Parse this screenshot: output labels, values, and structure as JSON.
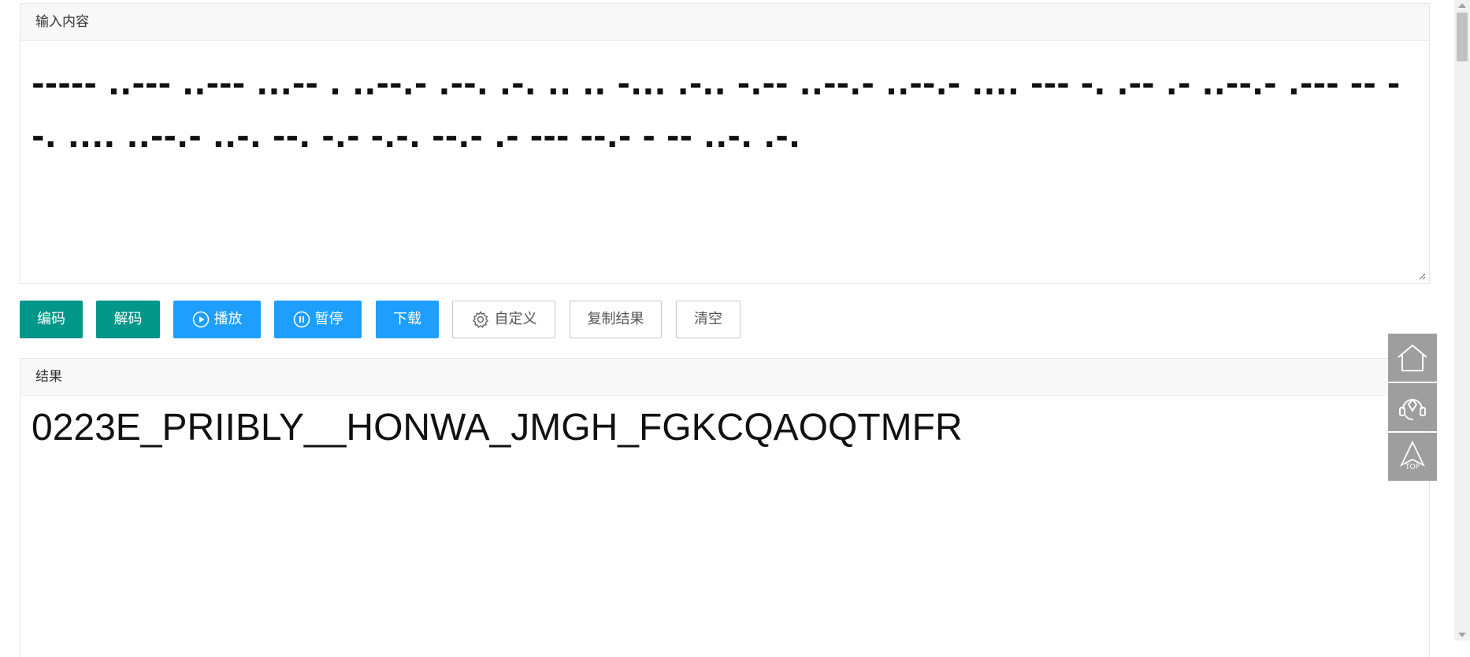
{
  "input": {
    "header": "输入内容",
    "value": "----- ..--- ..--- ...-- . ..--.- .--. .-. .. .. -... .-.. -.-- ..--.- ..--.- .... --- -. .-- .- ..--.- .--- -- --. .... ..--.- ..-. --. -.- -.-. --.- .- --- --.- - -- ..-. .-."
  },
  "buttons": {
    "encode": "编码",
    "decode": "解码",
    "play": "播放",
    "pause": "暂停",
    "download": "下载",
    "custom": "自定义",
    "copy": "复制结果",
    "clear": "清空"
  },
  "result": {
    "header": "结果",
    "value": "0223E_PRIIBLY__HONWA_JMGH_FGKCQAOQTMFR"
  },
  "side_tools": {
    "top_label": "TOP"
  },
  "colors": {
    "green": "#009688",
    "blue": "#1e9fff",
    "tool_gray": "#9e9e9e"
  }
}
